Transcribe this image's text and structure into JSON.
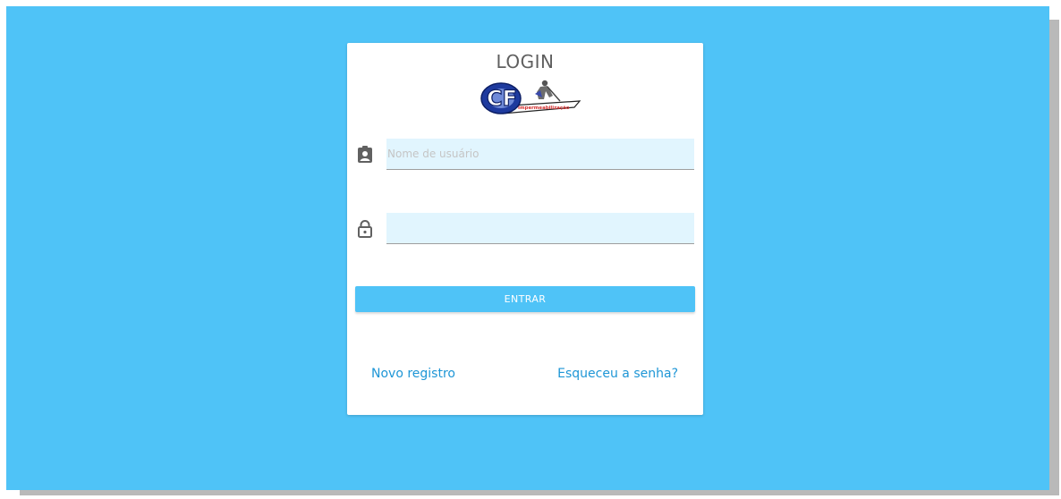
{
  "login": {
    "title": "LOGIN",
    "logo": {
      "name": "cf-impermeabilizacao-logo",
      "text": "Impermeabilização",
      "letters": "CF"
    },
    "username": {
      "icon": "account-box-icon",
      "placeholder": "Nome de usuário",
      "value": ""
    },
    "password": {
      "icon": "lock-icon",
      "placeholder": "",
      "value": ""
    },
    "submit_label": "ENTRAR",
    "links": {
      "register": "Novo registro",
      "forgot": "Esqueceu a senha?"
    }
  },
  "colors": {
    "background": "#4fc3f7",
    "input_fill": "#e1f5fe",
    "link": "#1e96d6",
    "button": "#4fc3f7"
  }
}
